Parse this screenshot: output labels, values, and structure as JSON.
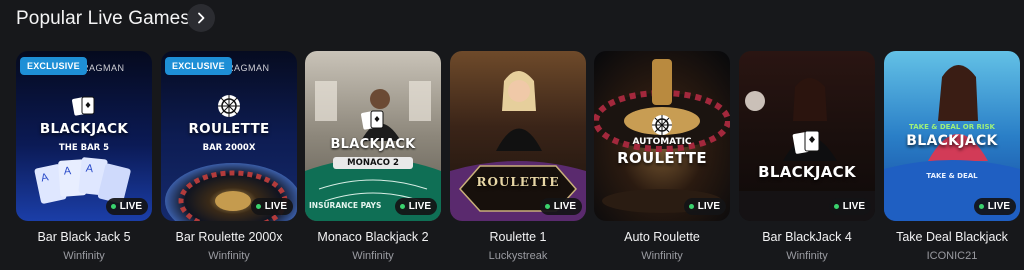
{
  "section": {
    "title": "Popular Live Games",
    "next_icon": "chevron-right-icon"
  },
  "live_label": "LIVE",
  "exclusive_label": "EXCLUSIVE",
  "brand_label": "RAGMAN",
  "colors": {
    "background": "#17181b",
    "live_dot": "#3ad26d",
    "exclusive_badge": "#1e8fd6",
    "provider_text": "#9a9ba1"
  },
  "games": [
    {
      "name": "Bar Black Jack 5",
      "provider": "Winfinity",
      "art_title": "BLACKJACK",
      "art_sub": "THE BAR 5",
      "exclusive": true
    },
    {
      "name": "Bar Roulette 2000x",
      "provider": "Winfinity",
      "art_title": "ROULETTE",
      "art_sub": "BAR 2000X",
      "exclusive": true
    },
    {
      "name": "Monaco Blackjack 2",
      "provider": "Winfinity",
      "art_title": "BLACKJACK",
      "art_sub": "MONACO 2",
      "art_note": "INSURANCE PAYS"
    },
    {
      "name": "Roulette 1",
      "provider": "Luckystreak",
      "art_title": "ROULETTE"
    },
    {
      "name": "Auto Roulette",
      "provider": "Winfinity",
      "art_title": "ROULETTE",
      "art_sub": "AUTOMATIC"
    },
    {
      "name": "Bar BlackJack 4",
      "provider": "Winfinity",
      "art_title": "BLACKJACK"
    },
    {
      "name": "Take Deal Blackjack",
      "provider": "ICONIC21",
      "art_title": "BLACKJACK",
      "art_sub": "TAKE & DEAL OR RISK",
      "art_note": "TAKE & DEAL"
    }
  ]
}
